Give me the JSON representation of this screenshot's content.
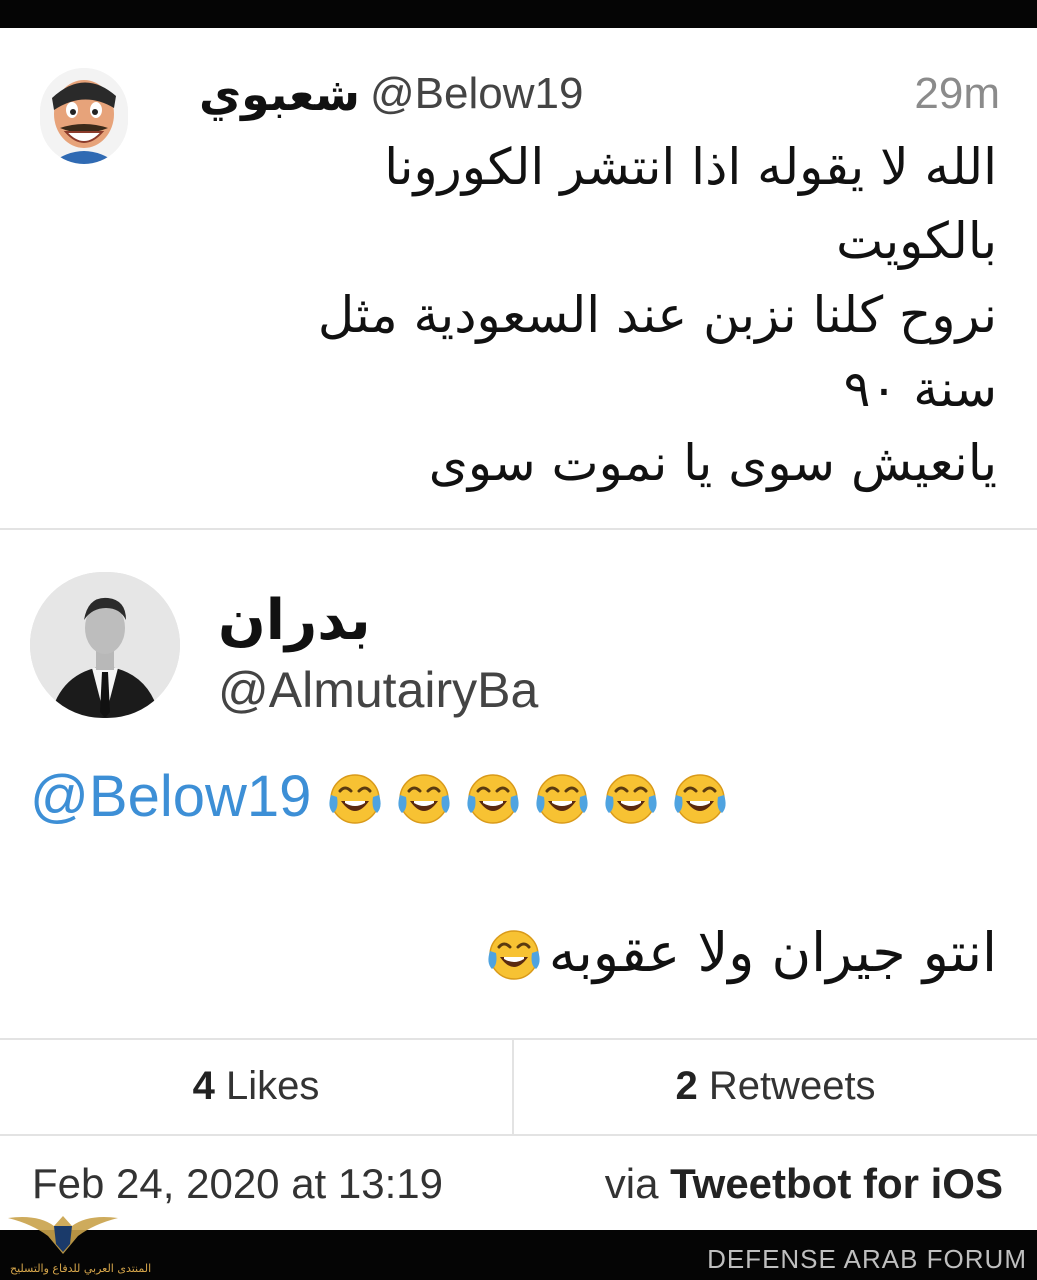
{
  "quoted_tweet": {
    "name": "شعبوي",
    "handle": "@Below19",
    "time": "29m",
    "text": "الله لا يقوله اذا انتشر الكورونا\nبالكويت\nنروح كلنا نزبن عند السعودية مثل\nسنة ٩٠\nيانعيش سوى يا نموت سوى"
  },
  "reply_tweet": {
    "name": "بدران",
    "handle": "@AlmutairyBa",
    "mention": "@Below19",
    "mention_emoji_count": 6,
    "text": "انتو جيران ولا عقوبه",
    "text_emoji_count": 1,
    "emoji_icon": "face-with-tears-of-joy-icon"
  },
  "stats": {
    "likes_count": "4",
    "likes_label": "Likes",
    "retweets_count": "2",
    "retweets_label": "Retweets",
    "date": "Feb 24, 2020 at 13:19",
    "via_prefix": "via",
    "client": "Tweetbot for iOS"
  },
  "watermark": {
    "text": "DEFENSE ARAB FORUM",
    "logo_caption": "المنتدى العربي للدفاع والتسليح"
  },
  "colors": {
    "mention_blue": "#3d8fd6",
    "muted_gray": "#8b8b8b",
    "divider": "#e3e3e3"
  }
}
